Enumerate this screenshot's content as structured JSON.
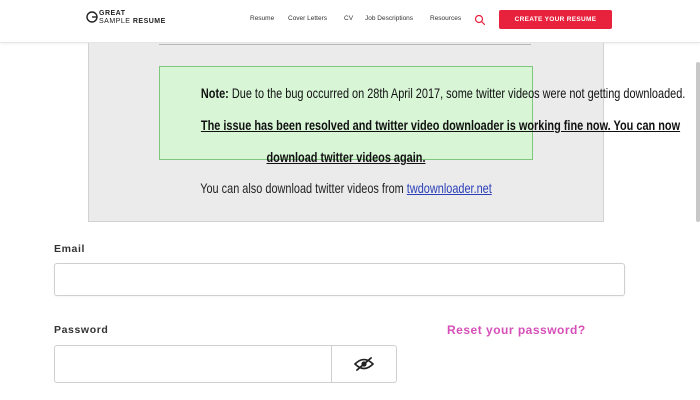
{
  "header": {
    "logo": {
      "line1": "GREAT",
      "line2_a": "SAMPLE",
      "line2_b": "RESUME"
    },
    "nav": [
      "Resume",
      "Cover Letters",
      "CV",
      "Job Descriptions",
      "Resources"
    ],
    "search_icon": "search-icon",
    "cta_label": "CREATE YOUR RESUME",
    "accent_color": "#e8213d"
  },
  "panel": {
    "note_label": "Note:",
    "note_text": " Due to the bug occurred on 28th April 2017, some twitter videos were not getting downloaded.",
    "resolved_line1": "The issue has been resolved and twitter video downloader is working fine now. You can now",
    "resolved_line2": "download twitter videos again.",
    "also_text": "You can also download twitter videos from ",
    "also_link": "twdownloader.net"
  },
  "form": {
    "email_label": "Email",
    "email_value": "",
    "password_label": "Password",
    "password_value": "",
    "reset_link": "Reset your password?",
    "toggle_icon": "eye-slash-icon",
    "link_color": "#d64fb8"
  }
}
